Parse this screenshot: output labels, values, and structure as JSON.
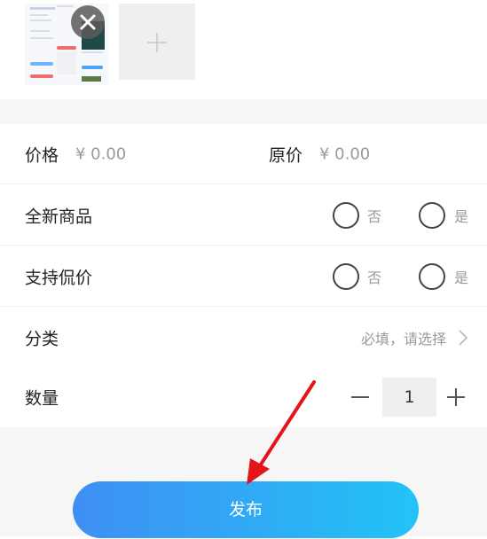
{
  "photos": {
    "add_icon": "plus-icon",
    "remove_icon": "close-icon"
  },
  "price": {
    "label": "价格",
    "value": "¥ 0.00",
    "original_label": "原价",
    "original_value": "¥ 0.00"
  },
  "brand_new": {
    "label": "全新商品",
    "no_label": "否",
    "yes_label": "是"
  },
  "negotiable": {
    "label": "支持侃价",
    "no_label": "否",
    "yes_label": "是"
  },
  "category": {
    "label": "分类",
    "placeholder": "必填，请选择"
  },
  "quantity": {
    "label": "数量",
    "value": "1"
  },
  "submit": {
    "label": "发布"
  },
  "colors": {
    "accent_start": "#3f8ff3",
    "accent_end": "#22c3f7",
    "arrow": "#e3151a"
  }
}
